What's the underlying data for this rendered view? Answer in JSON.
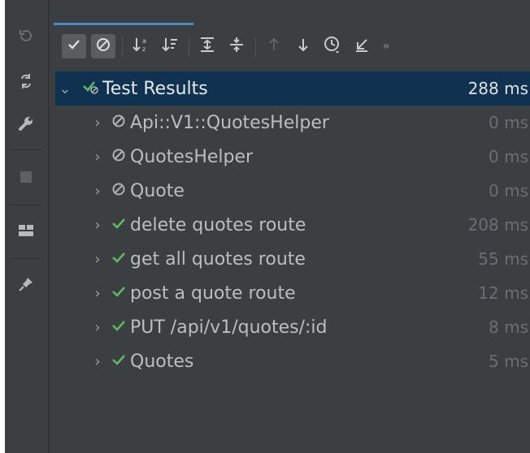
{
  "toolbar": {
    "buttons": [
      {
        "name": "show-passed",
        "icon": "check-icon"
      },
      {
        "name": "show-ignored",
        "icon": "ignored-icon"
      },
      {
        "name": "sort-alpha",
        "icon": "sort-alpha-icon"
      },
      {
        "name": "sort-duration",
        "icon": "sort-duration-icon"
      },
      {
        "name": "expand-all",
        "icon": "expand-all-icon"
      },
      {
        "name": "collapse-all",
        "icon": "collapse-all-icon"
      },
      {
        "name": "prev-failed",
        "icon": "arrow-up-icon"
      },
      {
        "name": "next-failed",
        "icon": "arrow-down-icon"
      },
      {
        "name": "test-history",
        "icon": "history-icon"
      },
      {
        "name": "import-tests",
        "icon": "import-icon"
      },
      {
        "name": "more",
        "icon": "chevrons-right-icon"
      }
    ]
  },
  "tree": {
    "root": {
      "label": "Test Results",
      "duration": "288 ms",
      "status": "passed-with-ignored"
    },
    "items": [
      {
        "label": "Api::V1::QuotesHelper",
        "duration": "0 ms",
        "status": "ignored"
      },
      {
        "label": "QuotesHelper",
        "duration": "0 ms",
        "status": "ignored"
      },
      {
        "label": "Quote",
        "duration": "0 ms",
        "status": "ignored"
      },
      {
        "label": "delete quotes route",
        "duration": "208 ms",
        "status": "passed"
      },
      {
        "label": "get all quotes route",
        "duration": "55 ms",
        "status": "passed"
      },
      {
        "label": "post a quote route",
        "duration": "12 ms",
        "status": "passed"
      },
      {
        "label": "PUT /api/v1/quotes/:id",
        "duration": "8 ms",
        "status": "passed"
      },
      {
        "label": "Quotes",
        "duration": "5 ms",
        "status": "passed"
      }
    ]
  },
  "colors": {
    "background": "#3c3f41",
    "selection": "#0e3250",
    "passed": "#5fb760",
    "accent": "#4a88c7"
  }
}
